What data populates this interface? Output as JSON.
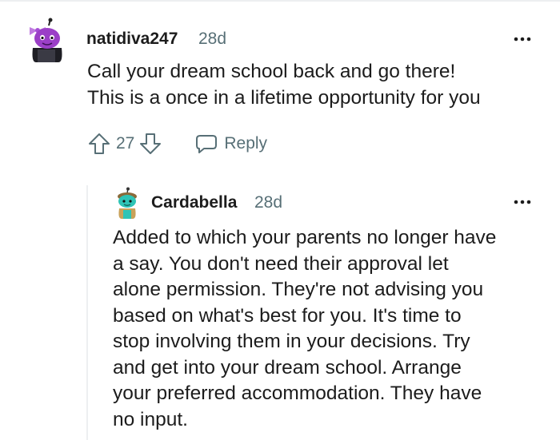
{
  "comments": [
    {
      "username": "natidiva247",
      "time": "28d",
      "body_lines": [
        "Call your dream school back and go there!",
        "This is a once in a lifetime opportunity for you"
      ],
      "votes": "27",
      "reply_label": "Reply"
    },
    {
      "username": "Cardabella",
      "time": "28d",
      "body_lines": [
        "Added to which your parents no longer have",
        "a say. You don't need their approval let",
        "alone permission. They're not advising you",
        "based on what's best for you. It's time to",
        "stop involving them in your decisions. Try",
        "and get into your dream school. Arrange",
        "your preferred accommodation. They have",
        "no input."
      ]
    }
  ],
  "icons": {
    "upvote": "arrow-up-outline-icon",
    "downvote": "arrow-down-outline-icon",
    "reply": "speech-bubble-icon",
    "more": "horizontal-ellipsis-icon"
  },
  "colors": {
    "meta_text": "#576f76",
    "body_text": "#1c1c1c",
    "thread_line": "#edeff1",
    "avatar1_accent": "#9b3fc7",
    "avatar2_accent": "#2ec4b6"
  }
}
